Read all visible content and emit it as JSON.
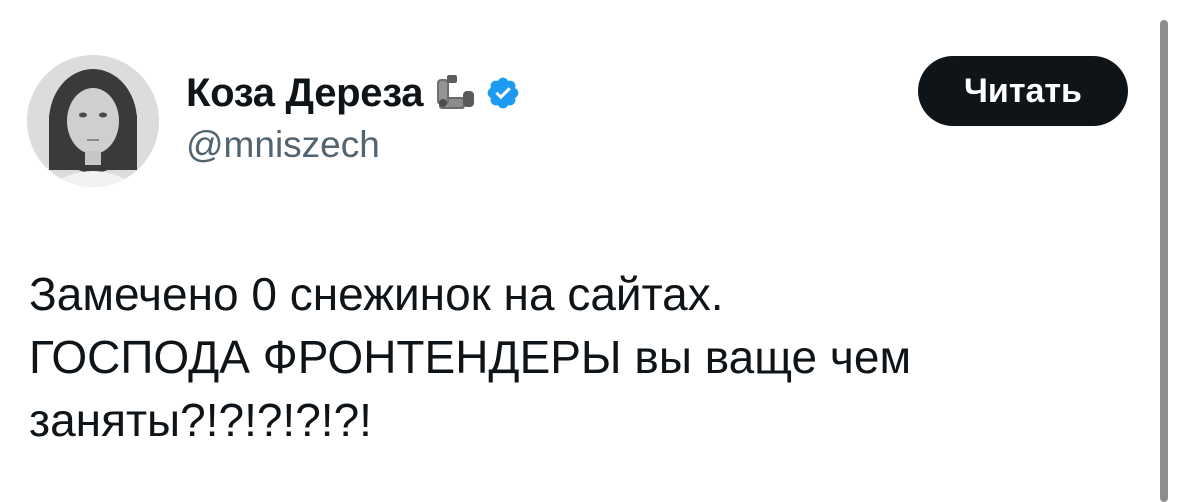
{
  "user": {
    "display_name": "Коза Дереза",
    "handle": "@mniszech",
    "emoji_icon": "flexed-biceps-prosthetic-icon",
    "verified_icon": "verified-badge-icon",
    "verified_color": "#1d9bf0"
  },
  "follow_button": {
    "label": "Читать"
  },
  "tweet": {
    "text": "Замечено 0 снежинок на сайтах.\nГОСПОДА ФРОНТЕНДЕРЫ вы ваще чем\nзаняты?!?!?!?!?!"
  }
}
